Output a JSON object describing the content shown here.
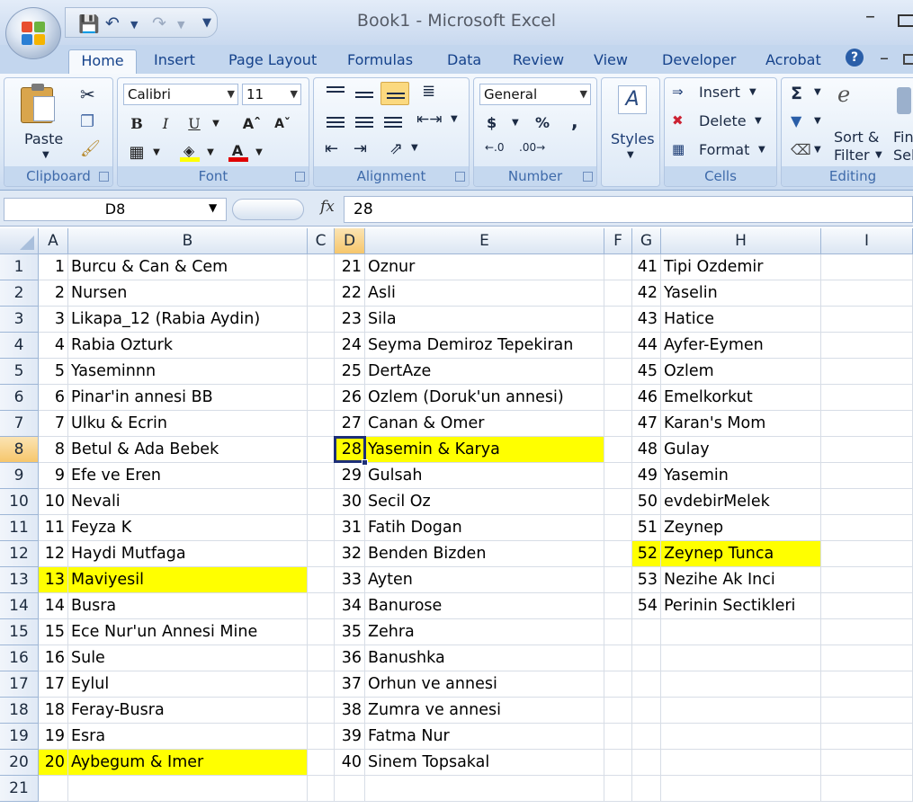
{
  "window": {
    "title": "Book1 - Microsoft Excel"
  },
  "tabs": [
    "Home",
    "Insert",
    "Page Layout",
    "Formulas",
    "Data",
    "Review",
    "View",
    "Developer",
    "Acrobat"
  ],
  "ribbon": {
    "clipboard": {
      "paste_label": "Paste",
      "group_label": "Clipboard"
    },
    "font": {
      "font_name": "Calibri",
      "font_size": "11",
      "group_label": "Font"
    },
    "alignment": {
      "group_label": "Alignment"
    },
    "number": {
      "format": "General",
      "currency": "$",
      "percent": "%",
      "comma": ",",
      "group_label": "Number"
    },
    "styles": {
      "label": "Styles"
    },
    "cells": {
      "insert_label": "Insert",
      "delete_label": "Delete",
      "format_label": "Format",
      "group_label": "Cells"
    },
    "editing": {
      "sort_label_1": "Sort &",
      "sort_label_2": "Filter",
      "find_label_1": "Fin",
      "find_label_2": "Sel",
      "group_label": "Editing"
    }
  },
  "formula_bar": {
    "name_box": "D8",
    "fx": "fx",
    "value": "28"
  },
  "columns": [
    "A",
    "B",
    "C",
    "D",
    "E",
    "F",
    "G",
    "H",
    "I"
  ],
  "selected": {
    "column": "D",
    "row": 8
  },
  "rows": [
    1,
    2,
    3,
    4,
    5,
    6,
    7,
    8,
    9,
    10,
    11,
    12,
    13,
    14,
    15,
    16,
    17,
    18,
    19,
    20,
    21
  ],
  "cells": {
    "A": [
      "1",
      "2",
      "3",
      "4",
      "5",
      "6",
      "7",
      "8",
      "9",
      "10",
      "11",
      "12",
      "13",
      "14",
      "15",
      "16",
      "17",
      "18",
      "19",
      "20",
      ""
    ],
    "B": [
      "Burcu & Can & Cem",
      "Nursen",
      "Likapa_12 (Rabia Aydin)",
      "Rabia Ozturk",
      "Yaseminnn",
      "Pinar'in annesi BB",
      "Ulku & Ecrin",
      "Betul & Ada Bebek",
      "Efe ve Eren",
      "Nevali",
      "Feyza K",
      "Haydi Mutfaga",
      "Maviyesil",
      "Busra",
      "Ece Nur'un Annesi Mine",
      "Sule",
      "Eylul",
      "Feray-Busra",
      "Esra",
      "Aybegum & Imer",
      ""
    ],
    "D": [
      "21",
      "22",
      "23",
      "24",
      "25",
      "26",
      "27",
      "28",
      "29",
      "30",
      "31",
      "32",
      "33",
      "34",
      "35",
      "36",
      "37",
      "38",
      "39",
      "40",
      ""
    ],
    "E": [
      "Oznur",
      "Asli",
      "Sila",
      "Seyma Demiroz Tepekiran",
      "DertAze",
      "Ozlem (Doruk'un annesi)",
      "Canan & Omer",
      "Yasemin & Karya",
      "Gulsah",
      "Secil Oz",
      "Fatih Dogan",
      "Benden Bizden",
      "Ayten",
      "Banurose",
      "Zehra",
      "Banushka",
      "Orhun ve annesi",
      "Zumra ve annesi",
      "Fatma Nur",
      "Sinem Topsakal",
      ""
    ],
    "G": [
      "41",
      "42",
      "43",
      "44",
      "45",
      "46",
      "47",
      "48",
      "49",
      "50",
      "51",
      "52",
      "53",
      "54",
      "",
      "",
      "",
      "",
      "",
      "",
      ""
    ],
    "H": [
      "Tipi Ozdemir",
      "Yaselin",
      "Hatice",
      "Ayfer-Eymen",
      "Ozlem",
      "Emelkorkut",
      "Karan's Mom",
      "Gulay",
      "Yasemin",
      "evdebirMelek",
      "Zeynep",
      "Zeynep Tunca",
      "Nezihe Ak Inci",
      "Perinin Sectikleri",
      "",
      "",
      "",
      "",
      "",
      "",
      ""
    ]
  },
  "highlighted": [
    {
      "row": 8,
      "cols": [
        "D",
        "E"
      ]
    },
    {
      "row": 13,
      "cols": [
        "A",
        "B"
      ]
    },
    {
      "row": 20,
      "cols": [
        "A",
        "B"
      ]
    },
    {
      "row": 12,
      "cols": [
        "G",
        "H"
      ]
    }
  ],
  "colors": {
    "highlight": "#ffff00",
    "selection_border": "#1d2f78",
    "header_selected": "#f6c66c"
  }
}
